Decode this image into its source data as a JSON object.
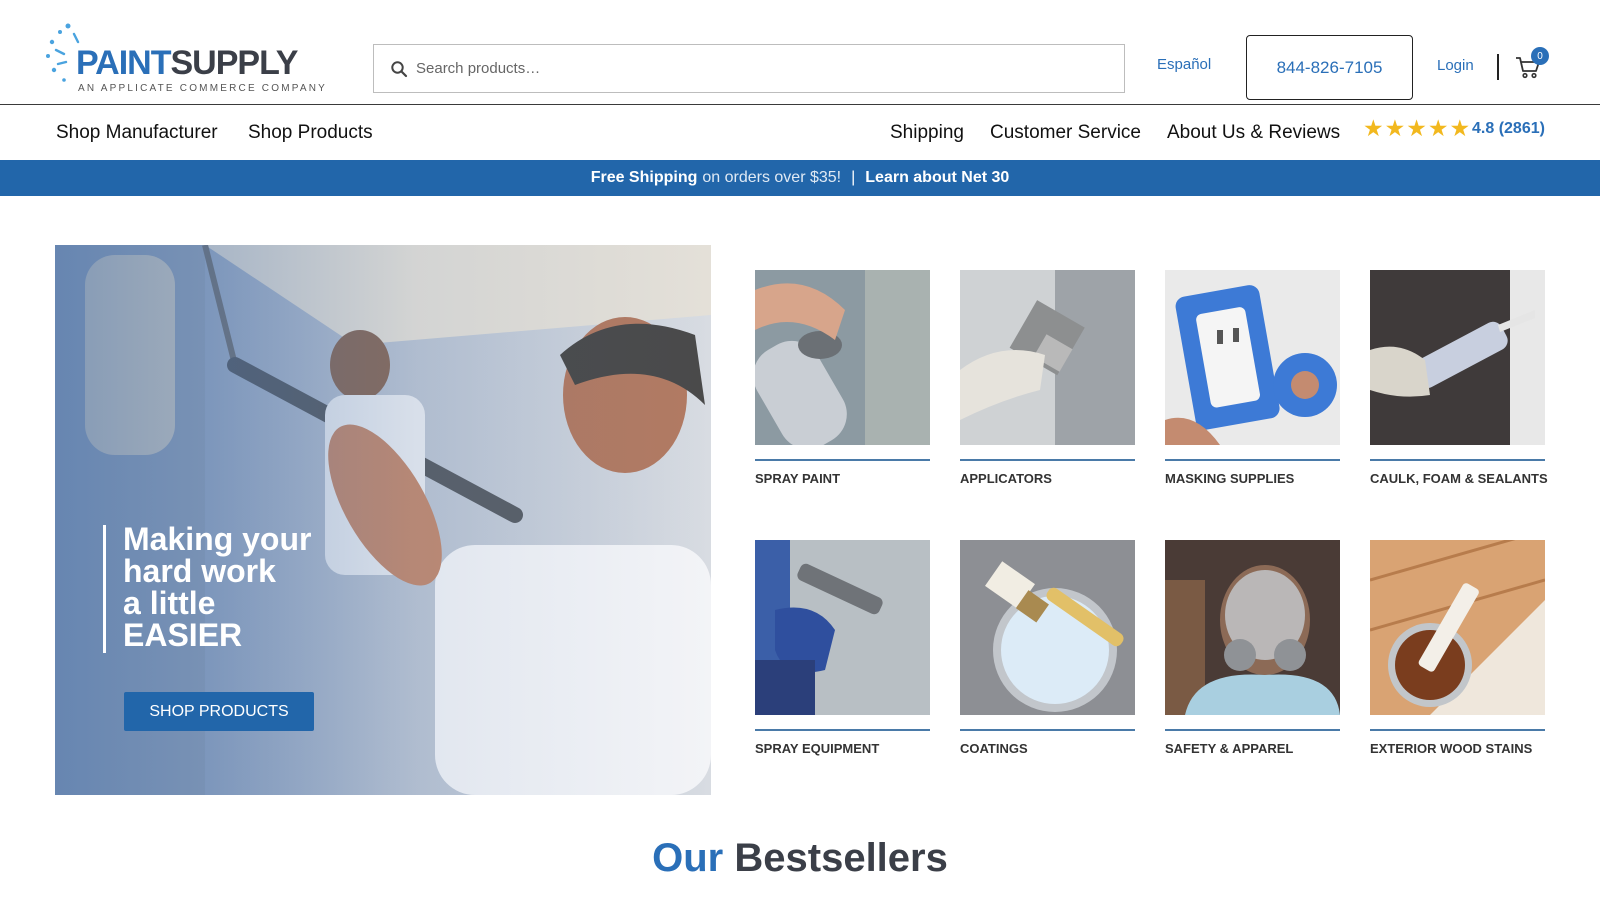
{
  "header": {
    "logo_text_blue": "PAINT",
    "logo_text_dark": "SUPPLY",
    "logo_tagline": "AN APPLICATE COMMERCE COMPANY",
    "search_placeholder": "Search products…",
    "language": "Español",
    "phone": "844-826-7105",
    "login": "Login",
    "cart_count": "0"
  },
  "nav": {
    "left": [
      "Shop Manufacturer",
      "Shop Products"
    ],
    "right": [
      "Shipping",
      "Customer Service",
      "About Us & Reviews"
    ],
    "rating_value": "4.8 (2861)",
    "star_count": 5
  },
  "promo": {
    "free_shipping": "Free Shipping",
    "orders_text": "on orders over $35!",
    "separator": "|",
    "net30": "Learn about Net 30"
  },
  "hero": {
    "line1": "Making your",
    "line2": "hard work",
    "line3": "a little",
    "line4": "EASIER",
    "button": "SHOP PRODUCTS"
  },
  "categories": [
    {
      "label": "SPRAY PAINT",
      "icon": "spray-can"
    },
    {
      "label": "APPLICATORS",
      "icon": "paint-brush"
    },
    {
      "label": "MASKING SUPPLIES",
      "icon": "tape"
    },
    {
      "label": "CAULK, FOAM & SEALANTS",
      "icon": "caulk-gun"
    },
    {
      "label": "SPRAY EQUIPMENT",
      "icon": "spray-gun"
    },
    {
      "label": "COATINGS",
      "icon": "paint-can"
    },
    {
      "label": "SAFETY & APPAREL",
      "icon": "respirator"
    },
    {
      "label": "EXTERIOR WOOD STAINS",
      "icon": "stain-can"
    }
  ],
  "bestsellers": {
    "word1": "Our",
    "word2": "Bestsellers"
  },
  "colors": {
    "brand_blue": "#2a6fb8",
    "promo_blue": "#2266aa",
    "star_gold": "#f2b81e",
    "dark": "#3b3f48"
  }
}
